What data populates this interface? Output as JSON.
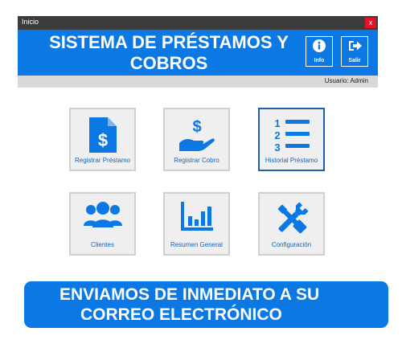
{
  "window": {
    "title": "Inicio",
    "close_label": "x"
  },
  "header": {
    "title_line1": "SISTEMA DE PRÉSTAMOS Y",
    "title_line2": "COBROS",
    "info_label": "Info",
    "exit_label": "Salir"
  },
  "status": {
    "user": "Usuario: Admin"
  },
  "tiles": [
    {
      "label": "Registrar Préstamo",
      "icon": "loan-document-icon"
    },
    {
      "label": "Registrar Cobro",
      "icon": "hand-dollar-icon"
    },
    {
      "label": "Historial Préstamo",
      "icon": "numbered-list-icon"
    },
    {
      "label": "Clientes",
      "icon": "users-icon"
    },
    {
      "label": "Resumen General",
      "icon": "bar-chart-icon"
    },
    {
      "label": "Configuración",
      "icon": "tools-icon"
    }
  ],
  "banner": {
    "line1": "ENVIAMOS DE INMEDIATO A SU",
    "line2": "CORREO ELECTRÓNICO"
  },
  "colors": {
    "accent": "#0b78e3",
    "titlebar": "#3c3c3c",
    "close": "#e81123",
    "tile_label": "#1565c0"
  }
}
